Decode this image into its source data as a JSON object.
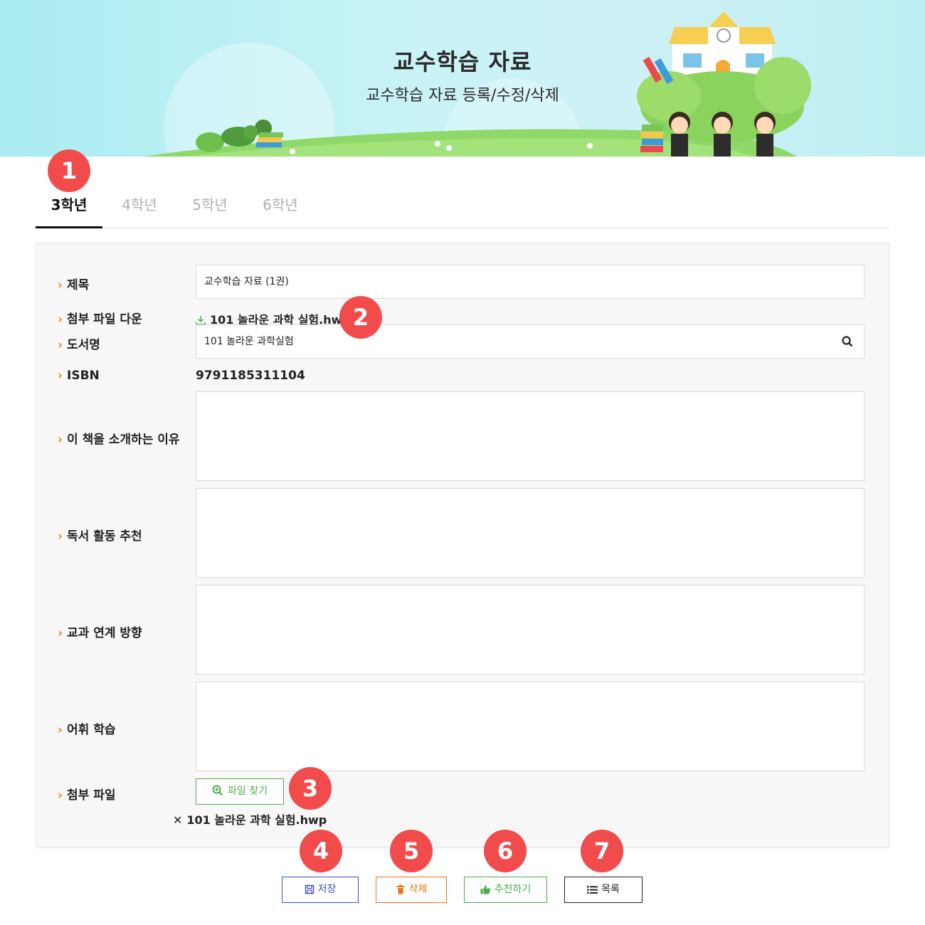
{
  "banner": {
    "title": "교수학습 자료",
    "subtitle": "교수학습 자료 등록/수정/삭제"
  },
  "tabs": [
    {
      "label": "3학년",
      "active": true
    },
    {
      "label": "4학년",
      "active": false
    },
    {
      "label": "5학년",
      "active": false
    },
    {
      "label": "6학년",
      "active": false
    }
  ],
  "markers": [
    "1",
    "2",
    "3",
    "4",
    "5",
    "6",
    "7"
  ],
  "form": {
    "title_label": "제목",
    "title_value": "교수학습 자료 (1권)",
    "download_label": "첨부 파일 다운",
    "download_file": "101 놀라운 과학 실험.hwp",
    "book_label": "도서명",
    "book_value": "101 놀라운 과학실험",
    "isbn_label": "ISBN",
    "isbn_value": "9791185311104",
    "reason_label": "이 책을 소개하는 이유",
    "activity_label": "독서 활동 추천",
    "subject_label": "교과 연계 방향",
    "vocab_label": "어휘 학습",
    "attach_label": "첨부 파일",
    "find_file_button": "파일 찾기",
    "attached_file": "101 놀라운 과학 실험.hwp"
  },
  "buttons": {
    "save": "저장",
    "delete": "삭제",
    "recommend": "추천하기",
    "list": "목록"
  },
  "colors": {
    "accent_red": "#f24b4b",
    "chevron_orange": "#f08a24",
    "save_blue": "#3a4fbf",
    "delete_orange": "#e8731e",
    "recommend_green": "#4cae4c"
  }
}
